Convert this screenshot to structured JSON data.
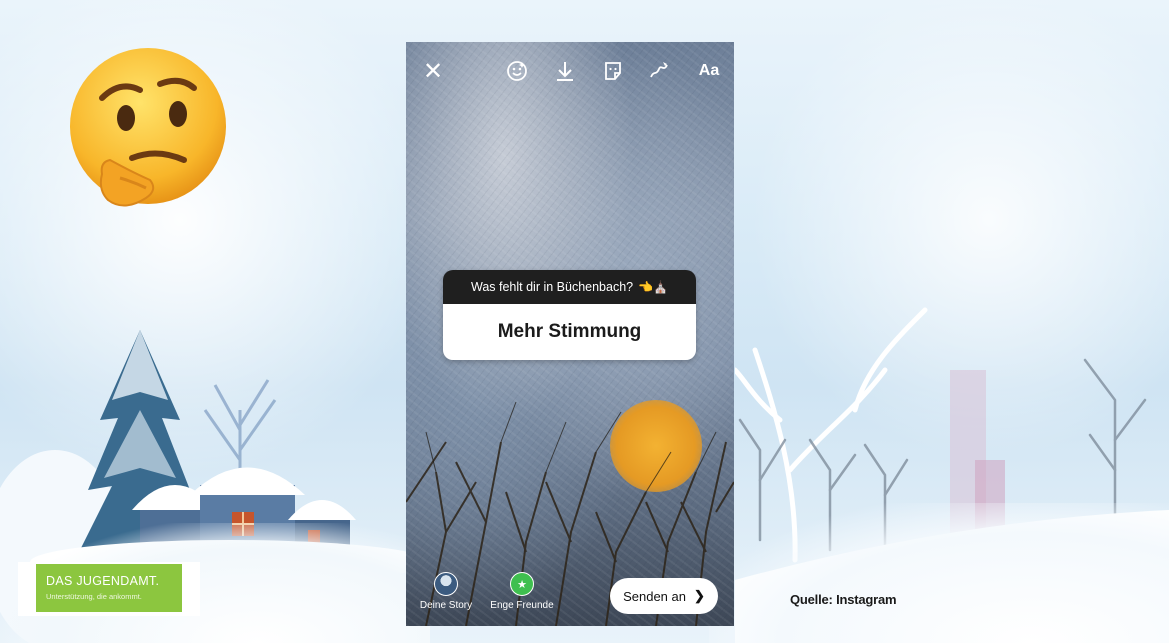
{
  "story": {
    "toolbar": {
      "close_icon": "close-icon",
      "face_filter_icon": "face-effect-icon",
      "download_icon": "download-icon",
      "sticker_icon": "sticker-icon",
      "draw_icon": "draw-icon",
      "text_label": "Aa"
    },
    "question_sticker": {
      "question": "Was fehlt dir in Büchenbach?",
      "answer": "Mehr Stimmung"
    },
    "bottom": {
      "your_story_label": "Deine Story",
      "close_friends_label": "Enge Freunde",
      "send_label": "Senden an"
    }
  },
  "logo": {
    "title": "DAS JUGENDAMT.",
    "subtitle": "Unterstützung, die ankommt."
  },
  "source": "Quelle: Instagram",
  "colors": {
    "logo_green": "#8cc63f",
    "sticker_header": "#1f1f1f",
    "sun": "#e59a24"
  }
}
